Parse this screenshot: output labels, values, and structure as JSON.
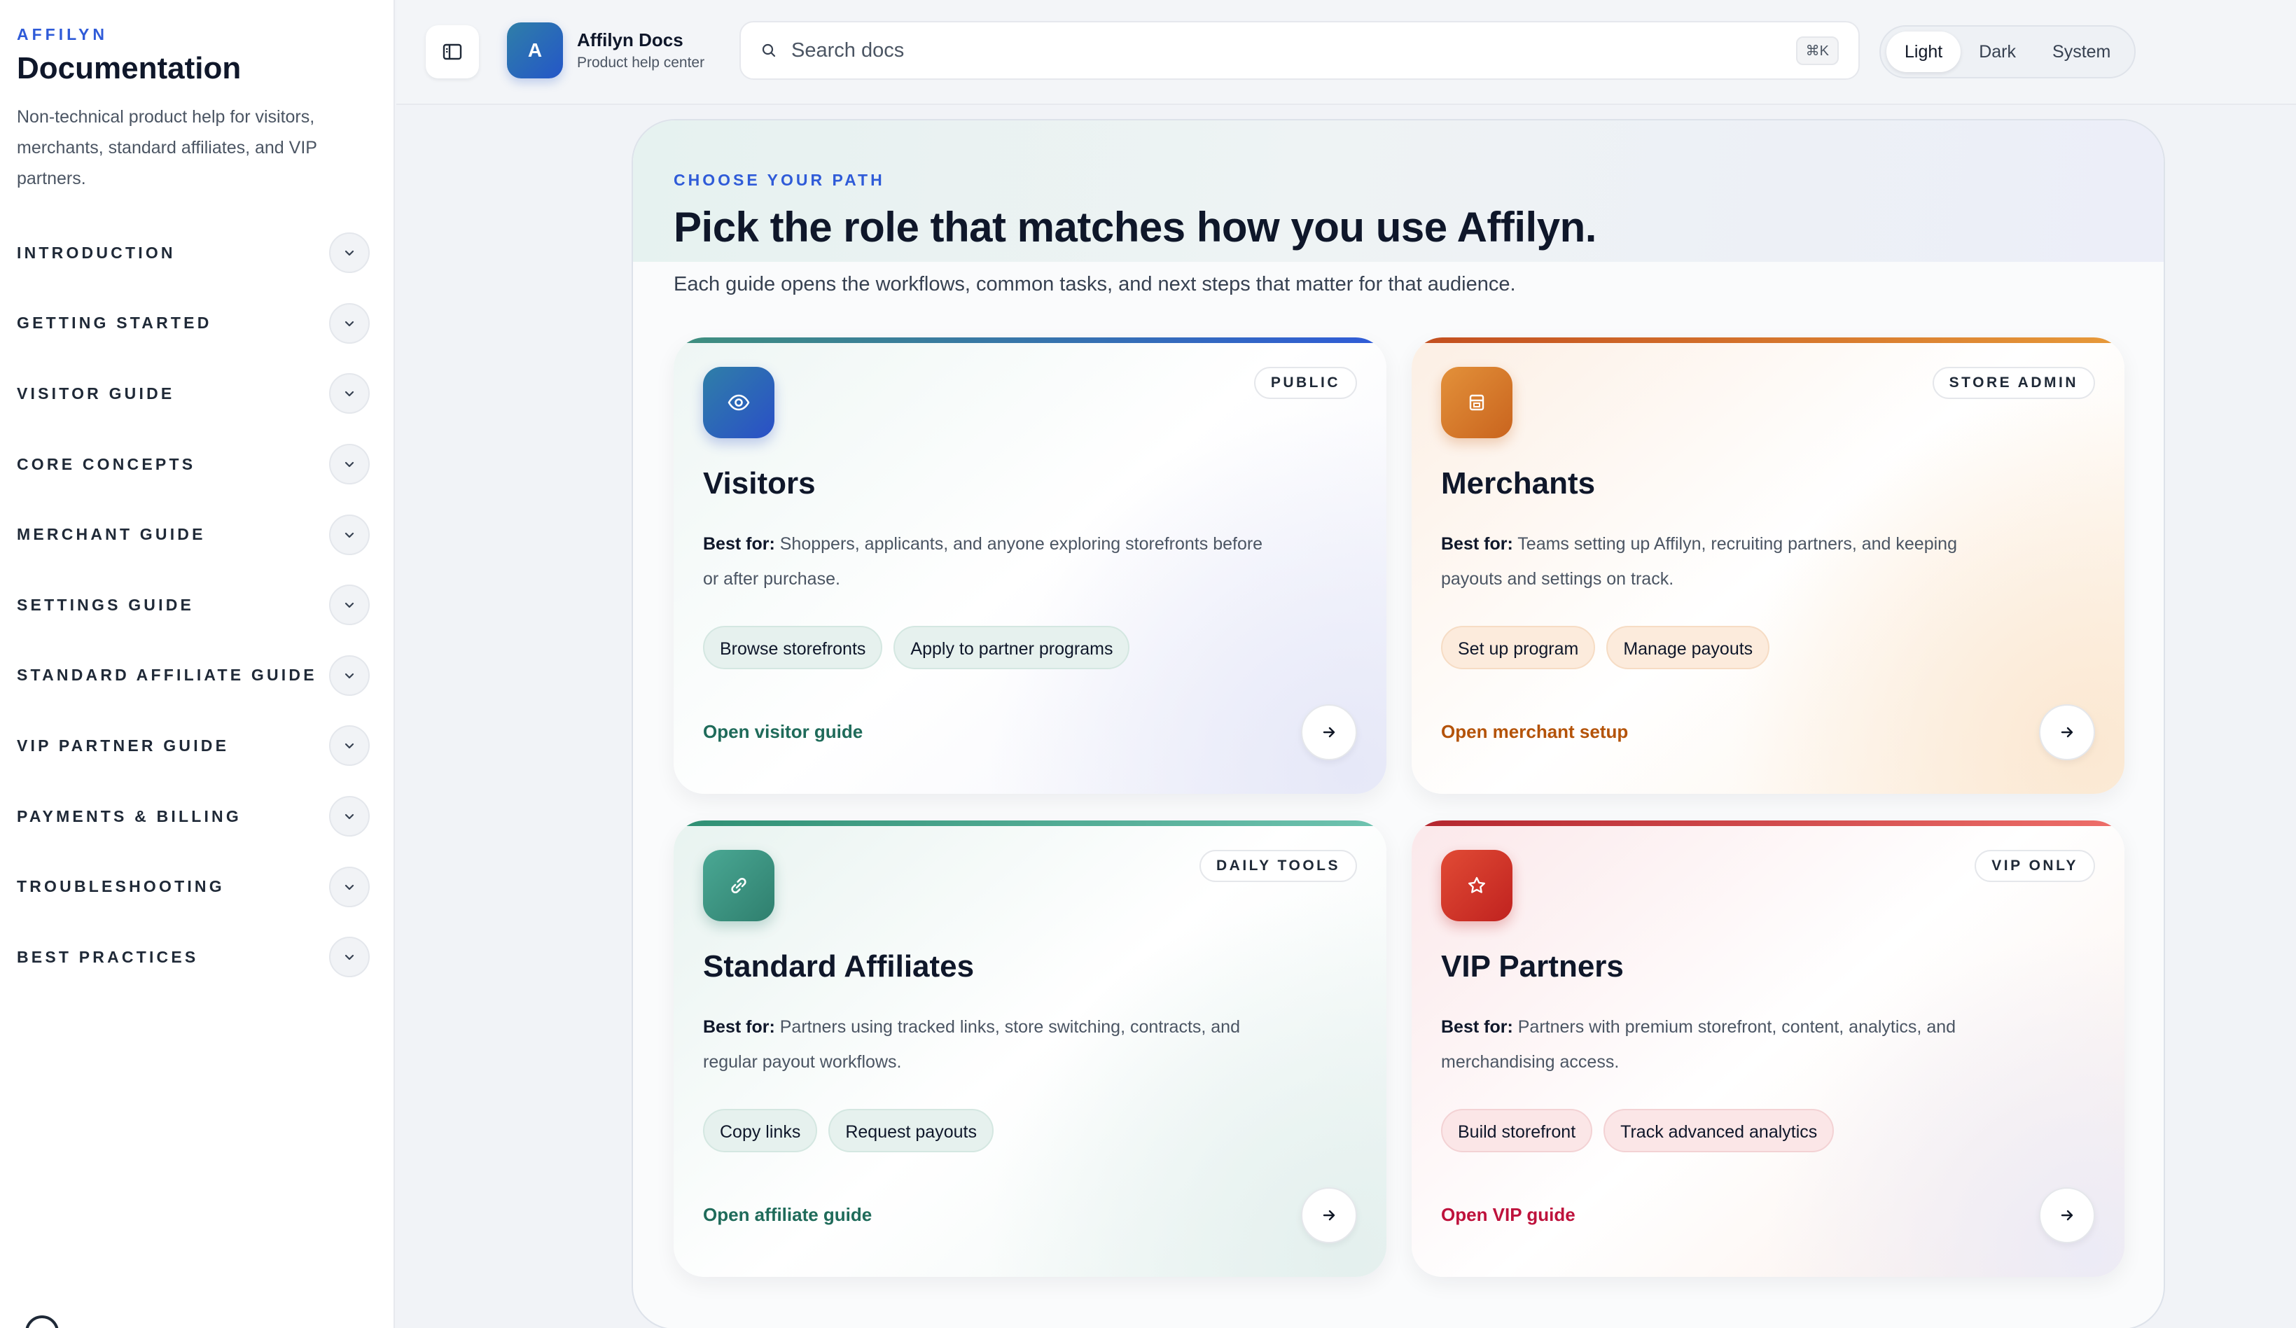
{
  "sidebar": {
    "kicker": "AFFILYN",
    "title": "Documentation",
    "description": "Non-technical product help for visitors, merchants, standard affiliates, and VIP partners.",
    "items": [
      {
        "label": "INTRODUCTION"
      },
      {
        "label": "GETTING STARTED"
      },
      {
        "label": "VISITOR GUIDE"
      },
      {
        "label": "CORE CONCEPTS"
      },
      {
        "label": "MERCHANT GUIDE"
      },
      {
        "label": "SETTINGS GUIDE"
      },
      {
        "label": "STANDARD AFFILIATE GUIDE"
      },
      {
        "label": "VIP PARTNER GUIDE"
      },
      {
        "label": "PAYMENTS & BILLING"
      },
      {
        "label": "TROUBLESHOOTING"
      },
      {
        "label": "BEST PRACTICES"
      }
    ]
  },
  "topbar": {
    "avatar_letter": "A",
    "app_name": "Affilyn Docs",
    "app_subtitle": "Product help center",
    "search_placeholder": "Search docs",
    "search_shortcut": "⌘K",
    "theme_options": [
      "Light",
      "Dark",
      "System"
    ],
    "theme_selected": "Light"
  },
  "hero": {
    "kicker": "CHOOSE YOUR PATH",
    "headline": "Pick the role that matches how you use Affilyn.",
    "lede": "Each guide opens the workflows, common tasks, and next steps that matter for that audience."
  },
  "cards": [
    {
      "title": "Visitors",
      "tag": "PUBLIC",
      "best_label": "Best for:",
      "best_text": "Shoppers, applicants, and anyone exploring storefronts before or after purchase.",
      "chips": [
        "Browse storefronts",
        "Apply to partner programs"
      ],
      "cta": "Open visitor guide",
      "icon": "eye-icon",
      "accent": "#2f7fa8",
      "cta_color": "#1f6b5a"
    },
    {
      "title": "Merchants",
      "tag": "STORE ADMIN",
      "best_label": "Best for:",
      "best_text": "Teams setting up Affilyn, recruiting partners, and keeping payouts and settings on track.",
      "chips": [
        "Set up program",
        "Manage payouts"
      ],
      "cta": "Open merchant setup",
      "icon": "storefront-icon",
      "accent": "#d9751f",
      "cta_color": "#b45309"
    },
    {
      "title": "Standard Affiliates",
      "tag": "DAILY TOOLS",
      "best_label": "Best for:",
      "best_text": "Partners using tracked links, store switching, contracts, and regular payout workflows.",
      "chips": [
        "Copy links",
        "Request payouts"
      ],
      "cta": "Open affiliate guide",
      "icon": "link-icon",
      "accent": "#3f9a86",
      "cta_color": "#1f6b5a"
    },
    {
      "title": "VIP Partners",
      "tag": "VIP ONLY",
      "best_label": "Best for:",
      "best_text": "Partners with premium storefront, content, analytics, and merchandising access.",
      "chips": [
        "Build storefront",
        "Track advanced analytics"
      ],
      "cta": "Open VIP guide",
      "icon": "star-icon",
      "accent": "#d93a2b",
      "cta_color": "#be123c"
    }
  ]
}
